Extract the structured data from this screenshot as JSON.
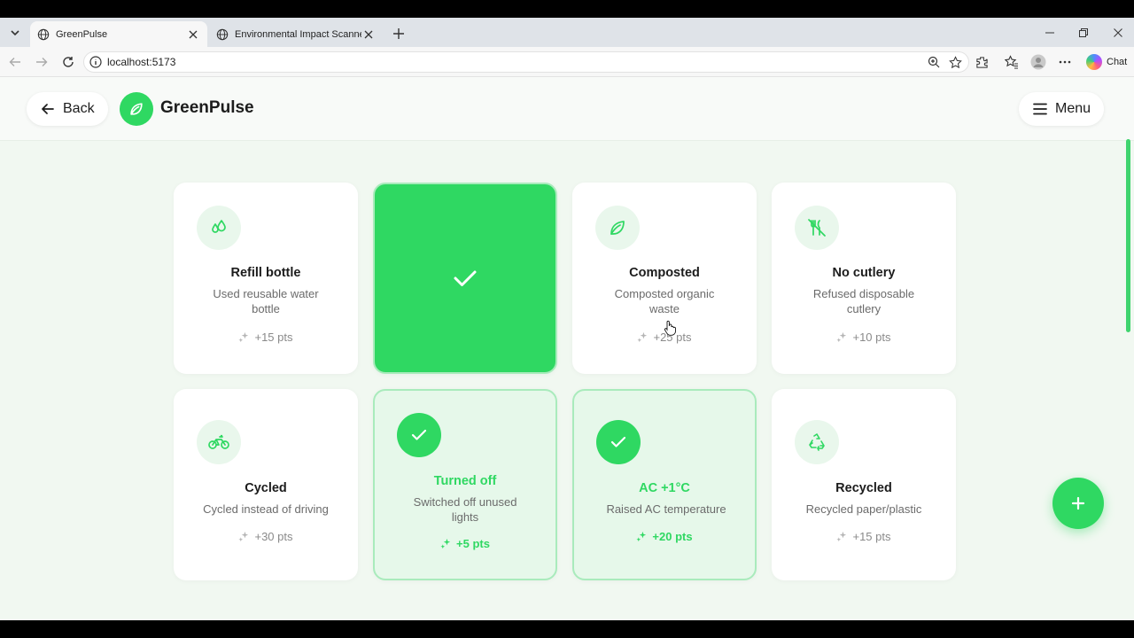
{
  "browser": {
    "tabs": [
      {
        "title": "GreenPulse",
        "active": true
      },
      {
        "title": "Environmental Impact Scanner",
        "active": false
      }
    ],
    "url": "localhost:5173",
    "chat_label": "Chat"
  },
  "header": {
    "back_label": "Back",
    "brand": "GreenPulse",
    "menu_label": "Menu"
  },
  "colors": {
    "accent": "#2fd862",
    "selected_bg": "#e6f8ea",
    "page_bg": "#f1f8f1"
  },
  "actions": [
    {
      "title": "Refill bottle",
      "desc": "Used reusable water bottle",
      "pts": "+15 pts",
      "icon": "water-drops-icon",
      "state": "normal"
    },
    {
      "title": "",
      "desc": "",
      "pts": "",
      "icon": "check-icon",
      "state": "flipped"
    },
    {
      "title": "Composted",
      "desc": "Composted organic waste",
      "pts": "+25 pts",
      "icon": "leaf-icon",
      "state": "normal"
    },
    {
      "title": "No cutlery",
      "desc": "Refused disposable cutlery",
      "pts": "+10 pts",
      "icon": "no-cutlery-icon",
      "state": "normal"
    },
    {
      "title": "Cycled",
      "desc": "Cycled instead of driving",
      "pts": "+30 pts",
      "icon": "bicycle-icon",
      "state": "normal"
    },
    {
      "title": "Turned off",
      "desc": "Switched off unused lights",
      "pts": "+5 pts",
      "icon": "check-icon",
      "state": "selected"
    },
    {
      "title": "AC +1°C",
      "desc": "Raised AC temperature",
      "pts": "+20 pts",
      "icon": "check-icon",
      "state": "selected"
    },
    {
      "title": "Recycled",
      "desc": "Recycled paper/plastic",
      "pts": "+15 pts",
      "icon": "recycle-icon",
      "state": "normal"
    }
  ],
  "fab_icon": "plus-icon"
}
